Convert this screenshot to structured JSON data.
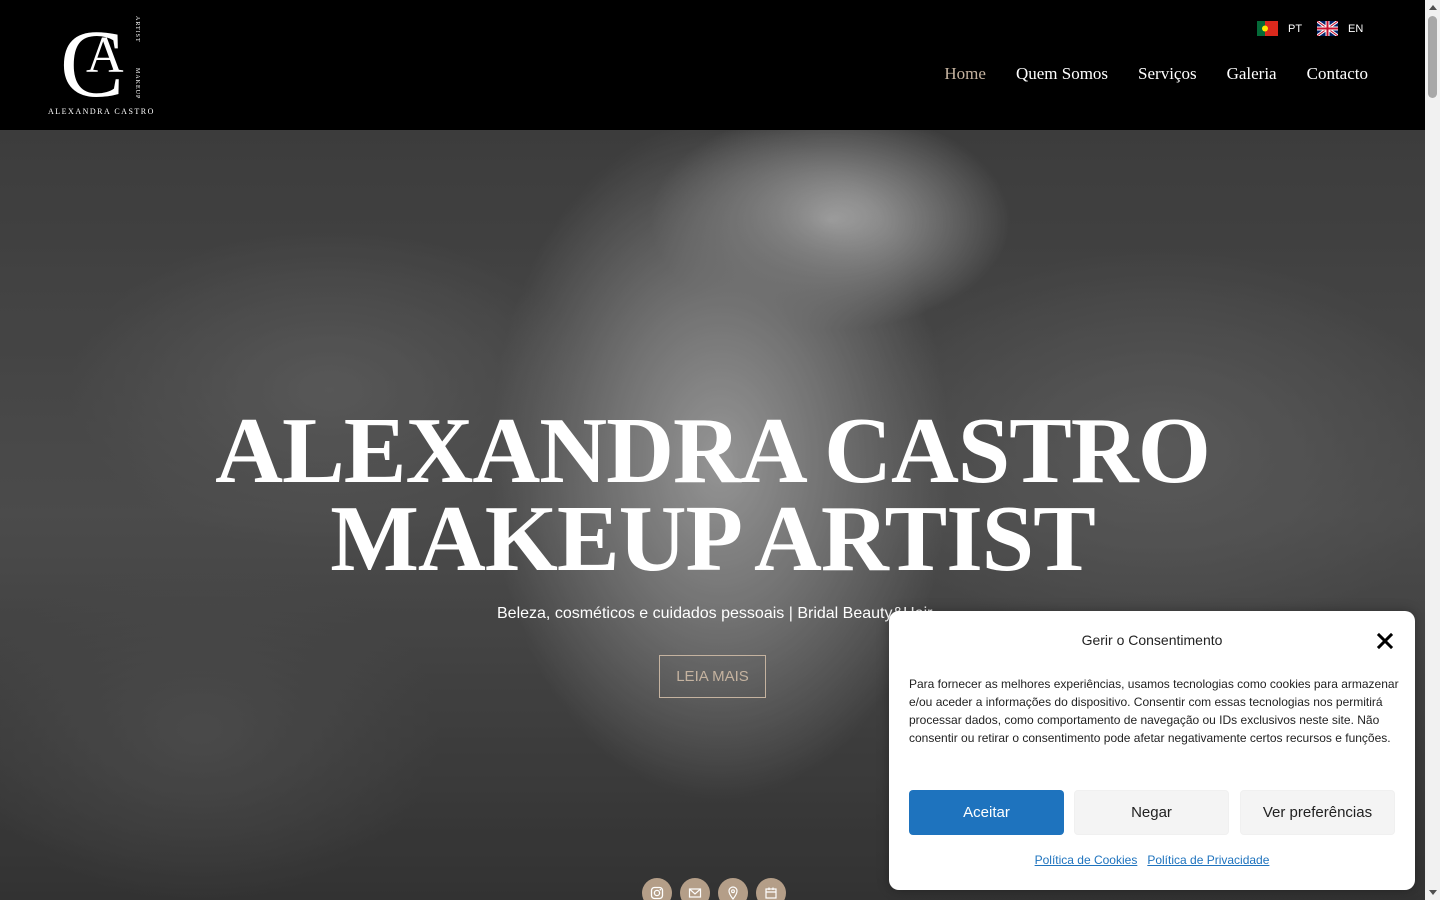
{
  "logo": {
    "monogram_c": "C",
    "monogram_a": "A",
    "side_text_1": "ARTIST",
    "side_text_2": "MAKEUP",
    "brand_name": "ALEXANDRA CASTRO"
  },
  "languages": [
    {
      "code": "PT",
      "flag": "portugal-flag"
    },
    {
      "code": "EN",
      "flag": "uk-flag"
    }
  ],
  "nav": {
    "items": [
      {
        "label": "Home",
        "active": true
      },
      {
        "label": "Quem Somos",
        "active": false
      },
      {
        "label": "Serviços",
        "active": false
      },
      {
        "label": "Galeria",
        "active": false
      },
      {
        "label": "Contacto",
        "active": false
      }
    ]
  },
  "hero": {
    "title_line1": "ALEXANDRA CASTRO",
    "title_line2": "MAKEUP ARTIST",
    "subtitle": "Beleza, cosméticos e cuidados pessoais | Bridal Beauty&Hair",
    "button_label": "LEIA MAIS",
    "social_icons": [
      "instagram-icon",
      "mail-icon",
      "location-icon",
      "calendar-icon"
    ]
  },
  "consent": {
    "title": "Gerir o Consentimento",
    "text": "Para fornecer as melhores experiências, usamos tecnologias como cookies para armazenar e/ou aceder a informações do dispositivo. Consentir com essas tecnologias nos permitirá processar dados, como comportamento de navegação ou IDs exclusivos neste site. Não consentir ou retirar o consentimento pode afetar negativamente certos recursos e funções.",
    "accept_label": "Aceitar",
    "deny_label": "Negar",
    "prefs_label": "Ver preferências",
    "cookie_policy_label": "Política de Cookies",
    "privacy_policy_label": "Política de Privacidade"
  },
  "colors": {
    "accent": "#c5b3a0",
    "social_bg": "#b49e88",
    "primary_button": "#1e73be"
  }
}
